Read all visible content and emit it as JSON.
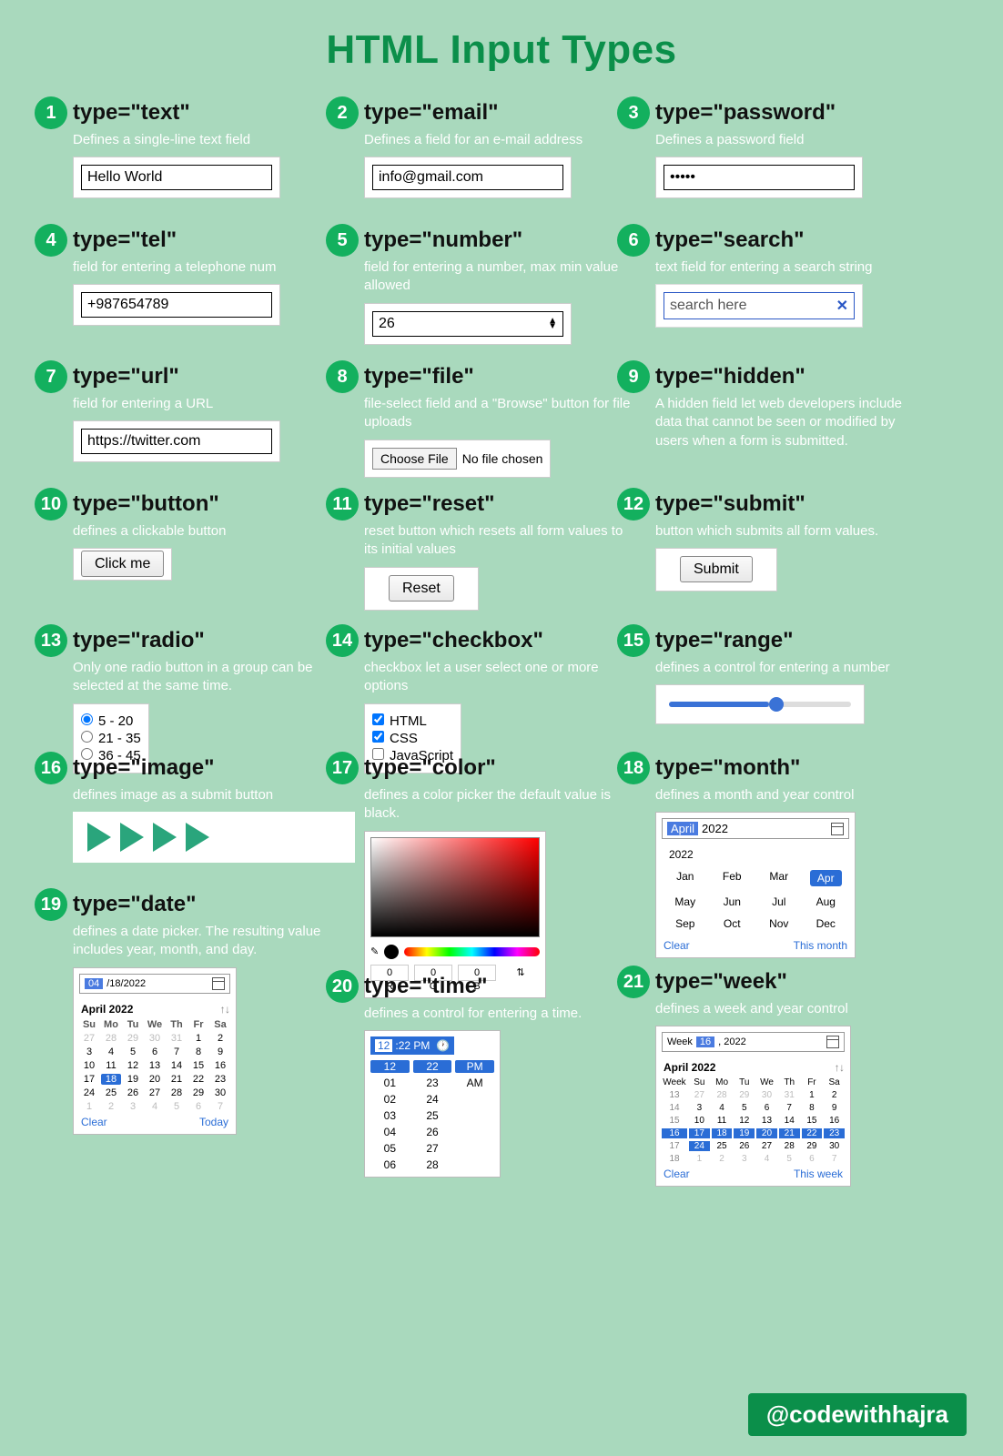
{
  "title": "HTML Input Types",
  "credit": "@codewithhajra",
  "items": [
    {
      "n": 1,
      "label": "type=\"text\"",
      "desc": "Defines a single-line text field",
      "value": "Hello World"
    },
    {
      "n": 2,
      "label": "type=\"email\"",
      "desc": "Defines a field for an e-mail address",
      "value": "info@gmail.com"
    },
    {
      "n": 3,
      "label": "type=\"password\"",
      "desc": "Defines a password field",
      "value": "•••••"
    },
    {
      "n": 4,
      "label": "type=\"tel\"",
      "desc": "field for entering a telephone num",
      "value": "+987654789"
    },
    {
      "n": 5,
      "label": "type=\"number\"",
      "desc": "field for entering a number, max min value allowed",
      "value": "26"
    },
    {
      "n": 6,
      "label": "type=\"search\"",
      "desc": "text field for entering a search string",
      "value": "search here"
    },
    {
      "n": 7,
      "label": "type=\"url\"",
      "desc": "field for entering a URL",
      "value": "https://twitter.com"
    },
    {
      "n": 8,
      "label": "type=\"file\"",
      "desc": "file-select field and a \"Browse\" button for file uploads",
      "button": "Choose File",
      "value": "No file chosen"
    },
    {
      "n": 9,
      "label": "type=\"hidden\"",
      "desc": "A hidden field let web developers include data that cannot be seen or modified by users when a form is submitted."
    },
    {
      "n": 10,
      "label": "type=\"button\"",
      "desc": "defines a clickable button",
      "button": "Click me"
    },
    {
      "n": 11,
      "label": "type=\"reset\"",
      "desc": "reset button which resets all form values to its initial values",
      "button": "Reset"
    },
    {
      "n": 12,
      "label": "type=\"submit\"",
      "desc": "button which submits all form values.",
      "button": "Submit"
    },
    {
      "n": 13,
      "label": "type=\"radio\"",
      "desc": "Only one radio button in a group can be selected at the same time.",
      "options": [
        "5 - 20",
        "21 - 35",
        "36 - 45"
      ],
      "selected": 0
    },
    {
      "n": 14,
      "label": "type=\"checkbox\"",
      "desc": "checkbox let a user select one or more options",
      "options": [
        "HTML",
        "CSS",
        "JavaScript"
      ],
      "checked": [
        true,
        true,
        false
      ]
    },
    {
      "n": 15,
      "label": "type=\"range\"",
      "desc": "defines a control for entering a number"
    },
    {
      "n": 16,
      "label": "type=\"image\"",
      "desc": "defines image as a submit button"
    },
    {
      "n": 17,
      "label": "type=\"color\"",
      "desc": "defines a color picker the default value is black.",
      "rgb": {
        "r": 0,
        "g": 0,
        "b": 0
      }
    },
    {
      "n": 18,
      "label": "type=\"month\"",
      "desc": "defines a month and year control",
      "value": "April 2022",
      "year": "2022",
      "months": [
        "Jan",
        "Feb",
        "Mar",
        "Apr",
        "May",
        "Jun",
        "Jul",
        "Aug",
        "Sep",
        "Oct",
        "Nov",
        "Dec"
      ],
      "selected": "Apr",
      "clear": "Clear",
      "thisMonth": "This month"
    },
    {
      "n": 19,
      "label": "type=\"date\"",
      "desc": "defines a date picker. The resulting value includes year, month, and day.",
      "value": "04/18/2022",
      "monthLabel": "April 2022",
      "clear": "Clear",
      "today": "Today",
      "dow": [
        "Su",
        "Mo",
        "Tu",
        "We",
        "Th",
        "Fr",
        "Sa"
      ]
    },
    {
      "n": 20,
      "label": "type=\"time\"",
      "desc": "defines a control for entering a time.",
      "value": "12:22 PM"
    },
    {
      "n": 21,
      "label": "type=\"week\"",
      "desc": "defines a week and year control",
      "value": "Week 16, 2022",
      "monthLabel": "April 2022",
      "clear": "Clear",
      "thisWeek": "This week",
      "dow": [
        "Su",
        "Mo",
        "Tu",
        "We",
        "Th",
        "Fr",
        "Sa"
      ]
    }
  ]
}
